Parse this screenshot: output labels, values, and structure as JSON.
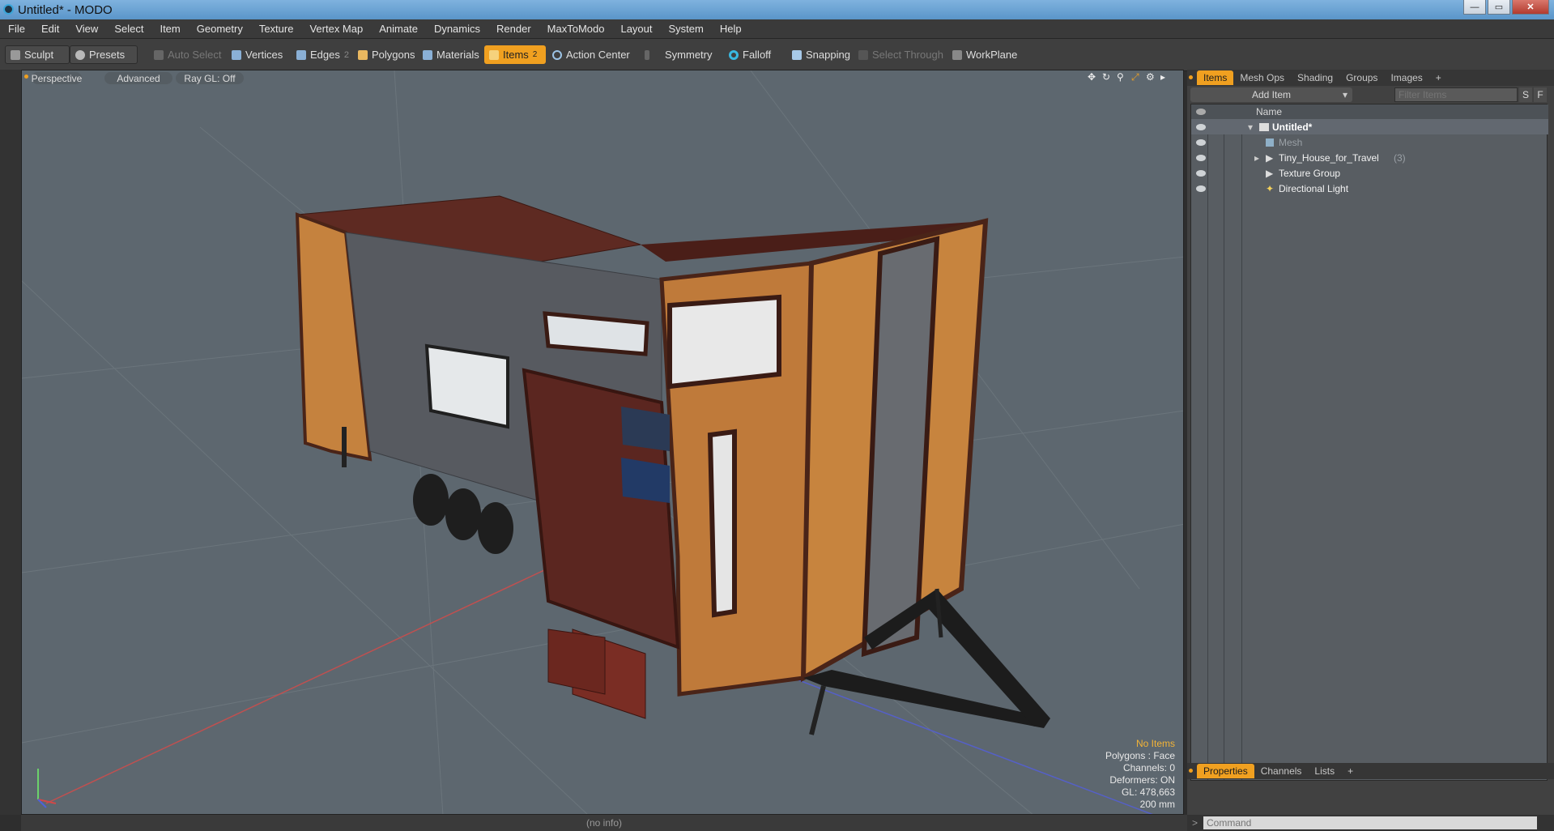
{
  "window": {
    "title": "Untitled* - MODO",
    "min": "0",
    "max": "1",
    "close": "r"
  },
  "menu": [
    "File",
    "Edit",
    "View",
    "Select",
    "Item",
    "Geometry",
    "Texture",
    "Vertex Map",
    "Animate",
    "Dynamics",
    "Render",
    "MaxToModo",
    "Layout",
    "System",
    "Help"
  ],
  "toolbar": {
    "sculpt": "Sculpt",
    "presets": "Presets",
    "auto_select": "Auto Select",
    "vertices": "Vertices",
    "edges": "Edges",
    "edges_count": "2",
    "polygons": "Polygons",
    "materials": "Materials",
    "items": "Items",
    "items_count": "2",
    "action_center": "Action Center",
    "symmetry": "Symmetry",
    "falloff": "Falloff",
    "snapping": "Snapping",
    "select_through": "Select Through",
    "workplane": "WorkPlane"
  },
  "viewport": {
    "perspective": "Perspective",
    "advanced": "Advanced",
    "raygl": "Ray GL: Off",
    "hud": {
      "no_items": "No Items",
      "polygons": "Polygons : Face",
      "channels": "Channels: 0",
      "deformers": "Deformers: ON",
      "gl": "GL: 478,663",
      "scale": "200 mm"
    },
    "axis": {
      "x": "x",
      "y": "y",
      "z": "z"
    }
  },
  "panel": {
    "tabs": [
      "Items",
      "Mesh Ops",
      "Shading",
      "Groups",
      "Images",
      "+"
    ],
    "add_item": "Add Item",
    "filter_placeholder": "Filter Items",
    "s": "S",
    "f": "F",
    "name_header": "Name",
    "items": [
      {
        "label": "Untitled*",
        "count": ""
      },
      {
        "label": "Mesh",
        "count": ""
      },
      {
        "label": "Tiny_House_for_Travel",
        "count": "(3)"
      },
      {
        "label": "Texture Group",
        "count": ""
      },
      {
        "label": "Directional Light",
        "count": ""
      }
    ],
    "bottom_tabs": [
      "Properties",
      "Channels",
      "Lists",
      "+"
    ],
    "command_placeholder": "Command"
  },
  "status": "(no info)",
  "colors": {
    "accent": "#f0a020",
    "viewport": "#5d676f"
  }
}
